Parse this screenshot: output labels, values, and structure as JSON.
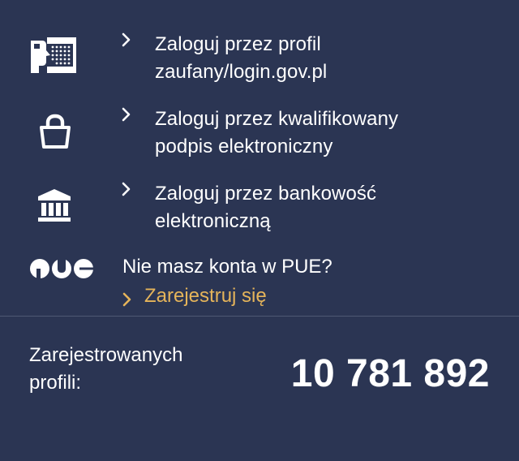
{
  "login_options": [
    {
      "icon": "id-card-icon",
      "label": "Zaloguj przez profil\nzaufany/login.gov.pl"
    },
    {
      "icon": "lock-icon",
      "label": "Zaloguj przez kwalifikowany\npodpis elektroniczny"
    },
    {
      "icon": "bank-icon",
      "label": "Zaloguj przez bankowość\nelektroniczną"
    }
  ],
  "registration": {
    "logo": "PUE",
    "logo_icon": "pue-logo-icon",
    "prompt": "Nie masz konta w PUE?",
    "link_label": "Zarejestruj się",
    "link_color": "#e5b45a"
  },
  "stats": {
    "label": "Zarejestrowanych\nprofili:",
    "value": "10 781 892"
  },
  "colors": {
    "background": "#2b3553",
    "text": "#ffffff",
    "accent": "#e5b45a",
    "divider": "#4f5874"
  }
}
